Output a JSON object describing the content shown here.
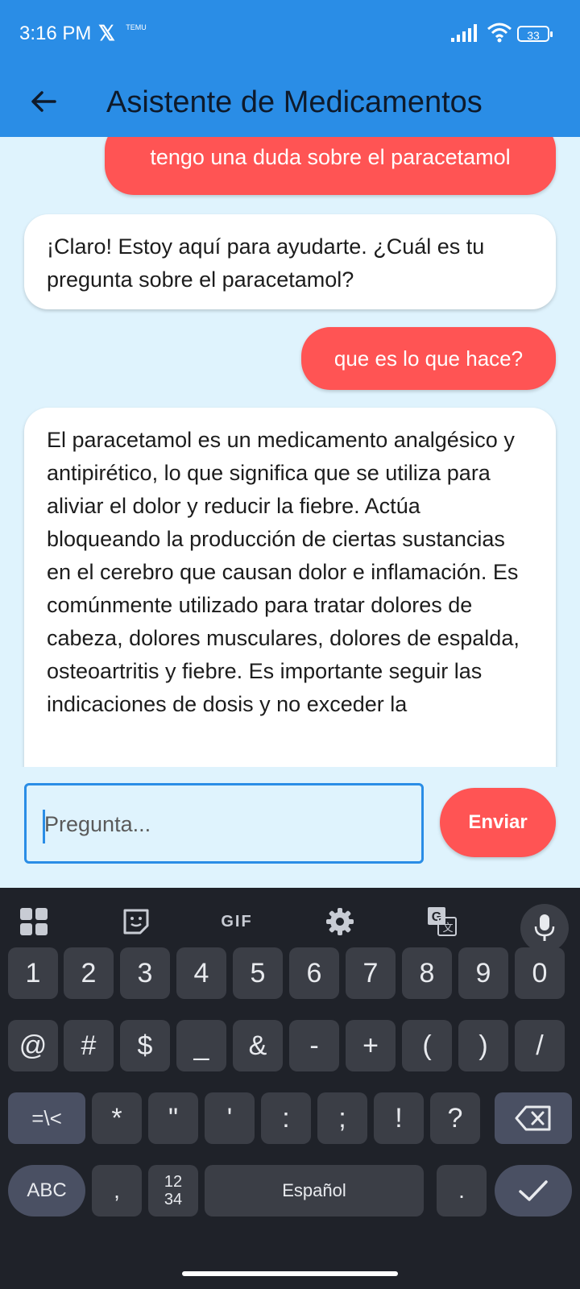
{
  "status_bar": {
    "time": "3:16 PM",
    "x_app": "𝕏",
    "temu_app": "TEMU",
    "battery": "33"
  },
  "app_bar": {
    "title": "Asistente de Medicamentos"
  },
  "chat": {
    "messages": [
      {
        "role": "user",
        "text": "tengo una duda sobre el paracetamol"
      },
      {
        "role": "assistant",
        "text": "¡Claro! Estoy aquí para ayudarte. ¿Cuál es tu pregunta sobre el paracetamol?"
      },
      {
        "role": "user",
        "text": "que es lo que hace?"
      },
      {
        "role": "assistant",
        "text": "El paracetamol es un medicamento analgésico y antipirético, lo que significa que se utiliza para aliviar el dolor y reducir la fiebre. Actúa bloqueando la producción de ciertas sustancias en el cerebro que causan dolor e inflamación. Es comúnmente utilizado para tratar dolores de cabeza, dolores musculares, dolores de espalda, osteoartritis y fiebre. Es importante seguir las indicaciones de dosis y no exceder la"
      }
    ]
  },
  "composer": {
    "placeholder": "Pregunta...",
    "value": "",
    "send_label": "Enviar"
  },
  "keyboard": {
    "toolbar": {
      "gif": "GIF"
    },
    "row1": [
      "1",
      "2",
      "3",
      "4",
      "5",
      "6",
      "7",
      "8",
      "9",
      "0"
    ],
    "row2": [
      "@",
      "#",
      "$",
      "_",
      "&",
      "-",
      "+",
      "(",
      ")",
      "/"
    ],
    "row3": [
      "=\\<",
      "*",
      "\"",
      "'",
      ":",
      ";",
      "!",
      "?"
    ],
    "row4": {
      "abc": "ABC",
      "comma": ",",
      "numbers_top": "12",
      "numbers_bottom": "34",
      "space": "Español",
      "period": "."
    }
  }
}
